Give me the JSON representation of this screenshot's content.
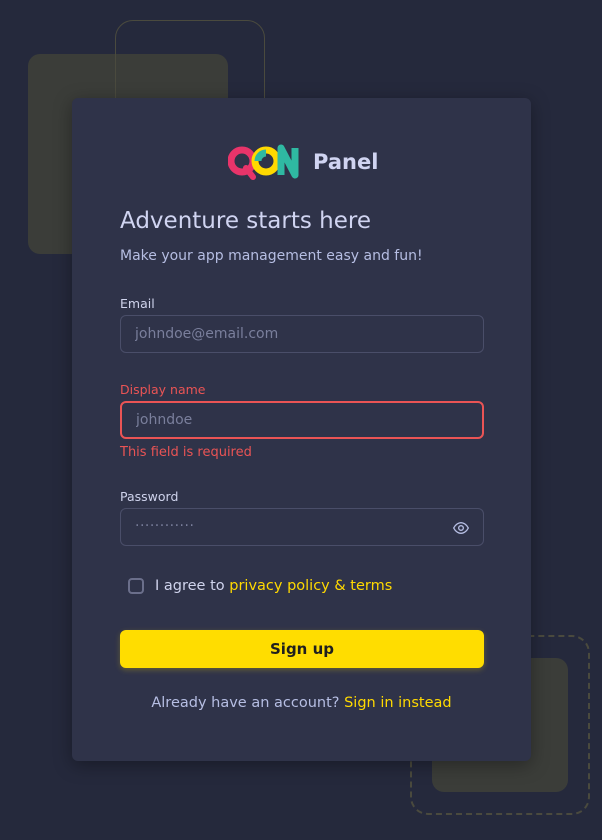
{
  "brand": {
    "name": "Panel",
    "logo_text": "QON"
  },
  "heading": {
    "title": "Adventure starts here",
    "subtitle": "Make your app management easy and fun!"
  },
  "form": {
    "email": {
      "label": "Email",
      "placeholder": "johndoe@email.com"
    },
    "display_name": {
      "label": "Display name",
      "placeholder": "johndoe",
      "error": "This field is required"
    },
    "password": {
      "label": "Password",
      "masked_value": "············"
    },
    "terms": {
      "prefix": "I agree to",
      "link": "privacy policy & terms"
    },
    "submit_label": "Sign up"
  },
  "footer": {
    "question": "Already have an account?",
    "link": "Sign in instead"
  },
  "colors": {
    "accent": "#ffdd00",
    "error": "#ea5455",
    "card_bg": "#2f3349",
    "page_bg": "#25293c"
  }
}
